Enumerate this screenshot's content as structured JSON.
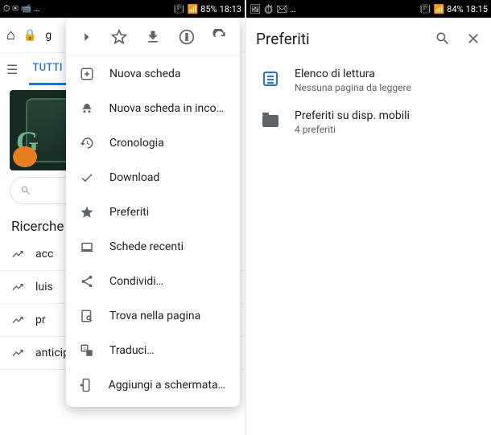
{
  "left": {
    "status": {
      "icons_l": "⏱ ✉ 📹 …",
      "signal": "📶",
      "batt": "85%",
      "time": "18:13"
    },
    "url_prefix": "g",
    "tab_active": "TUTTI",
    "search_heading": "Ricerche",
    "trends": [
      "acc",
      "luis",
      "pr",
      "anticipazioni uomini e donne oggi"
    ],
    "menu_top": {
      "forward": "→",
      "star": "☆",
      "download": "⬇",
      "info": "ⓘ",
      "reload": "↻"
    },
    "menu": [
      {
        "icon": "plus",
        "label": "Nuova scheda"
      },
      {
        "icon": "incognito",
        "label": "Nuova scheda in incog…"
      },
      {
        "icon": "history",
        "label": "Cronologia"
      },
      {
        "icon": "check",
        "label": "Download"
      },
      {
        "icon": "star",
        "label": "Preferiti"
      },
      {
        "icon": "recent",
        "label": "Schede recenti"
      },
      {
        "icon": "share",
        "label": "Condividi…"
      },
      {
        "icon": "find",
        "label": "Trova nella pagina"
      },
      {
        "icon": "translate",
        "label": "Traduci…"
      },
      {
        "icon": "addhome",
        "label": "Aggiungi a schermata H…"
      }
    ]
  },
  "right": {
    "status": {
      "icons_l": "🖼 ⏱ ✉ …",
      "signal": "📶",
      "batt": "84%",
      "time": "18:15"
    },
    "title": "Preferiti",
    "items": [
      {
        "icon": "article",
        "title": "Elenco di lettura",
        "sub": "Nessuna pagina da leggere"
      },
      {
        "icon": "folder",
        "title": "Preferiti su disp. mobili",
        "sub": "4 preferiti"
      }
    ]
  }
}
